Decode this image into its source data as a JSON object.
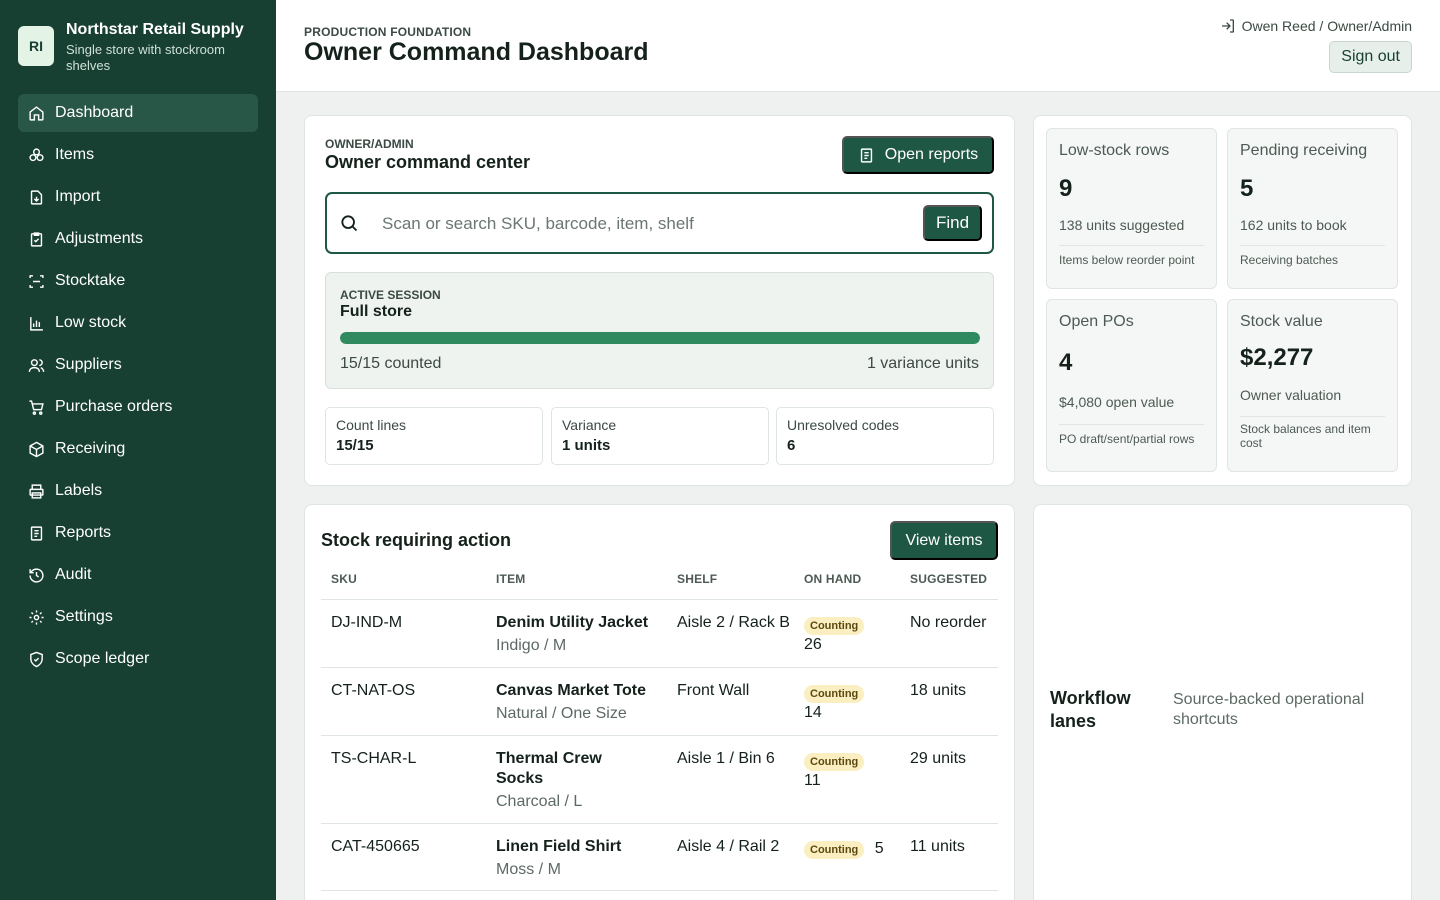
{
  "brand": {
    "initials": "RI",
    "name": "Northstar Retail Supply",
    "subtitle": "Single store with stockroom shelves"
  },
  "nav": [
    {
      "label": "Dashboard",
      "icon": "home-icon",
      "active": true
    },
    {
      "label": "Items",
      "icon": "items-icon"
    },
    {
      "label": "Import",
      "icon": "import-icon"
    },
    {
      "label": "Adjustments",
      "icon": "clipboard-check-icon"
    },
    {
      "label": "Stocktake",
      "icon": "scan-icon"
    },
    {
      "label": "Low stock",
      "icon": "bar-chart-icon"
    },
    {
      "label": "Suppliers",
      "icon": "users-icon"
    },
    {
      "label": "Purchase orders",
      "icon": "cart-icon"
    },
    {
      "label": "Receiving",
      "icon": "package-icon"
    },
    {
      "label": "Labels",
      "icon": "printer-icon"
    },
    {
      "label": "Reports",
      "icon": "document-icon"
    },
    {
      "label": "Audit",
      "icon": "history-icon"
    },
    {
      "label": "Settings",
      "icon": "gear-icon"
    },
    {
      "label": "Scope ledger",
      "icon": "shield-icon"
    }
  ],
  "header": {
    "eyebrow": "PRODUCTION FOUNDATION",
    "title": "Owner Command Dashboard",
    "user": "Owen Reed / Owner/Admin",
    "sign_out": "Sign out"
  },
  "command_center": {
    "role": "OWNER/ADMIN",
    "title": "Owner command center",
    "open_reports": "Open reports",
    "search_placeholder": "Scan or search SKU, barcode, item, shelf",
    "find": "Find",
    "session": {
      "eyebrow": "ACTIVE SESSION",
      "name": "Full store",
      "progress": 1.0,
      "counted": "15/15 counted",
      "variance": "1 variance units"
    },
    "stats": [
      {
        "label": "Count lines",
        "value": "15/15"
      },
      {
        "label": "Variance",
        "value": "1 units"
      },
      {
        "label": "Unresolved codes",
        "value": "6"
      }
    ]
  },
  "metrics": [
    {
      "label": "Low-stock rows",
      "value": "9",
      "sub": "138 units suggested",
      "note": "Items below reorder point"
    },
    {
      "label": "Pending receiving",
      "value": "5",
      "sub": "162 units to book",
      "note": "Receiving batches"
    },
    {
      "label": "Open POs",
      "value": "4",
      "sub": "$4,080 open value",
      "note": "PO draft/sent/partial rows"
    },
    {
      "label": "Stock value",
      "value": "$2,277",
      "sub": "Owner valuation",
      "note": "Stock balances and item cost"
    }
  ],
  "stock_table": {
    "title": "Stock requiring action",
    "view_items": "View items",
    "headers": [
      "SKU",
      "ITEM",
      "SHELF",
      "ON HAND",
      "SUGGESTED"
    ],
    "rows": [
      {
        "sku": "DJ-IND-M",
        "name": "Denim Utility Jacket",
        "variant": "Indigo / M",
        "shelf": "Aisle 2 / Rack B",
        "status": "Counting",
        "on_hand": "26",
        "suggested": "No reorder"
      },
      {
        "sku": "CT-NAT-OS",
        "name": "Canvas Market Tote",
        "variant": "Natural / One Size",
        "shelf": "Front Wall",
        "status": "Counting",
        "on_hand": "14",
        "suggested": "18 units"
      },
      {
        "sku": "TS-CHAR-L",
        "name": "Thermal Crew Socks",
        "variant": "Charcoal / L",
        "shelf": "Aisle 1 / Bin 6",
        "status": "Counting",
        "on_hand": "11",
        "suggested": "29 units"
      },
      {
        "sku": "CAT-450665",
        "name": "Linen Field Shirt",
        "variant": "Moss / M",
        "shelf": "Aisle 4 / Rail 2",
        "status": "Counting",
        "on_hand": "5",
        "suggested": "11 units"
      }
    ]
  },
  "workflow": {
    "title": "Workflow lanes",
    "subtitle": "Source-backed operational shortcuts"
  }
}
